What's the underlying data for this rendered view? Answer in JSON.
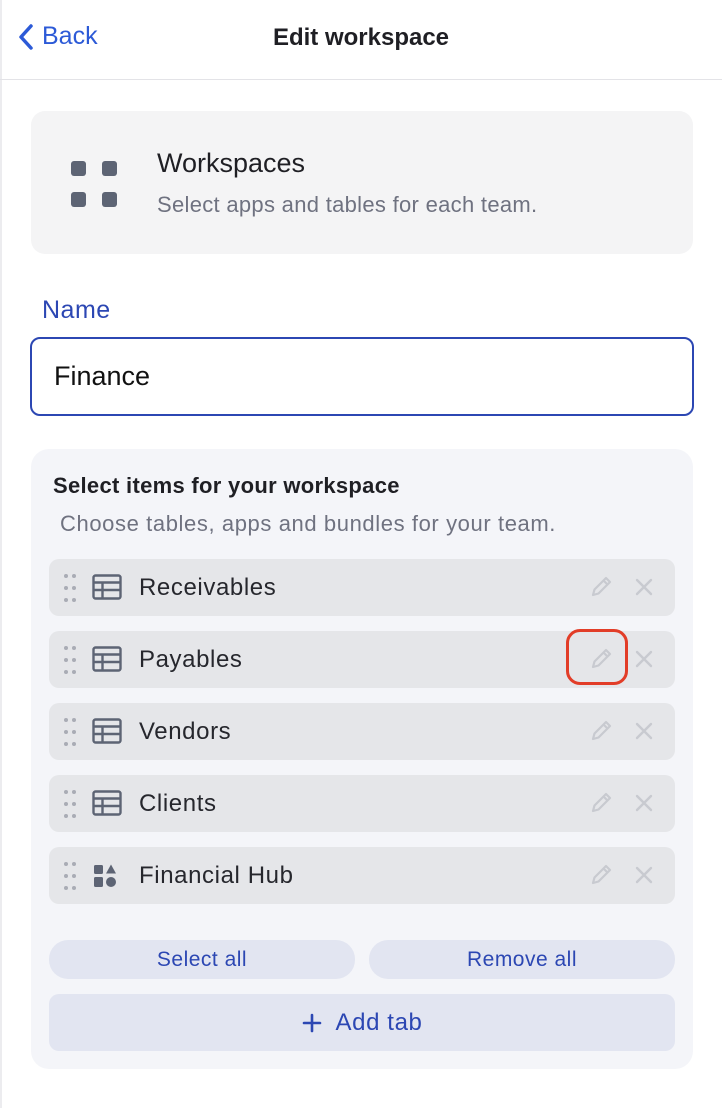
{
  "header": {
    "back_label": "Back",
    "title": "Edit workspace"
  },
  "intro": {
    "icon": "grid-icon",
    "title": "Workspaces",
    "subtitle": "Select apps and tables for each team."
  },
  "name_field": {
    "label": "Name",
    "value": "Finance"
  },
  "selection": {
    "title": "Select items for your workspace",
    "subtitle": "Choose tables, apps and bundles for your team.",
    "items": [
      {
        "label": "Receivables",
        "icon": "table-icon"
      },
      {
        "label": "Payables",
        "icon": "table-icon"
      },
      {
        "label": "Vendors",
        "icon": "table-icon"
      },
      {
        "label": "Clients",
        "icon": "table-icon"
      },
      {
        "label": "Financial Hub",
        "icon": "app-icon"
      }
    ],
    "select_all_label": "Select all",
    "remove_all_label": "Remove all",
    "add_tab_label": "Add tab"
  },
  "colors": {
    "accent": "#2c47b3",
    "link": "#2c5ad7",
    "highlight": "#e23d28"
  }
}
